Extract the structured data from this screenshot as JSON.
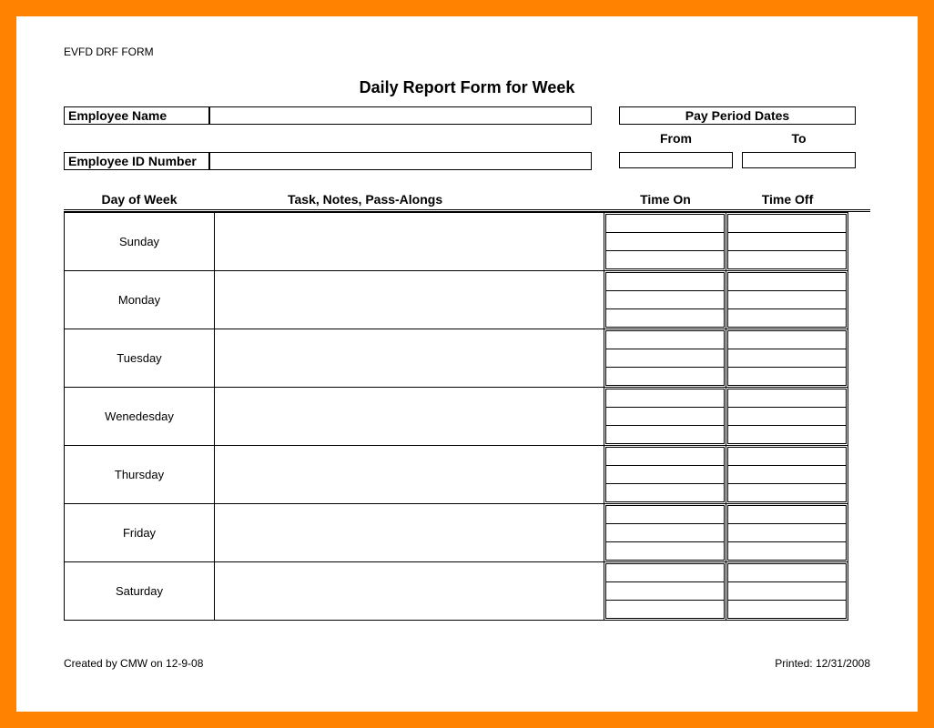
{
  "form_code": "EVFD DRF FORM",
  "title": "Daily Report Form for Week",
  "labels": {
    "employee_name": "Employee Name",
    "employee_id": "Employee ID Number",
    "pay_period": "Pay Period Dates",
    "from": "From",
    "to": "To"
  },
  "columns": {
    "day": "Day of Week",
    "task": "Task, Notes, Pass-Alongs",
    "time_on": "Time On",
    "time_off": "Time Off"
  },
  "days": [
    "Sunday",
    "Monday",
    "Tuesday",
    "Wenedesday",
    "Thursday",
    "Friday",
    "Saturday"
  ],
  "footer": {
    "created": "Created by CMW on 12-9-08",
    "printed": "Printed: 12/31/2008"
  },
  "values": {
    "employee_name": "",
    "employee_id": "",
    "from": "",
    "to": ""
  }
}
